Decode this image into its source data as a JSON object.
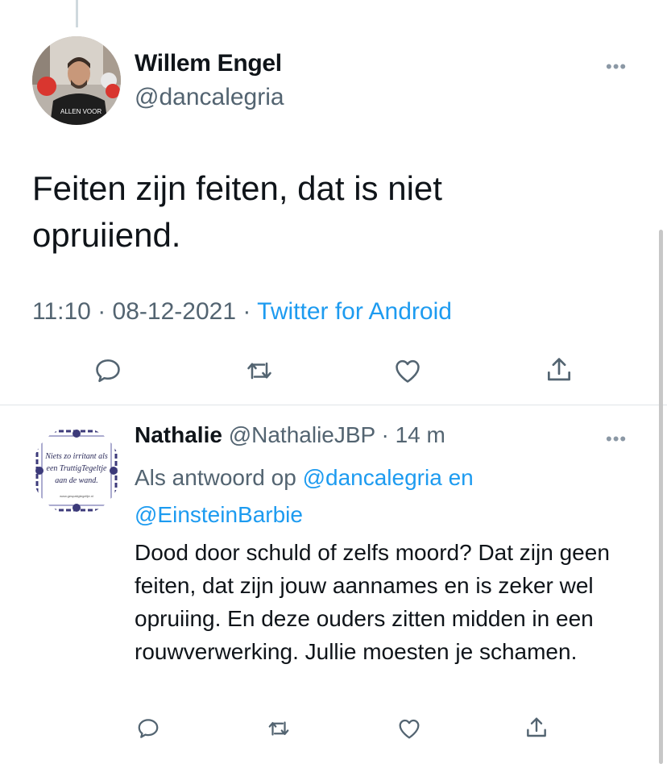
{
  "tweet": {
    "author_name": "Willem Engel",
    "author_handle": "@dancalegria",
    "avatar_shirt_text": "ALLEN VOOR",
    "text": "Feiten zijn feiten, dat is niet opruiiend.",
    "time": "11:10",
    "date": "08-12-2021",
    "separator": "·",
    "source": "Twitter for Android",
    "more_label": "•••"
  },
  "reply": {
    "author_name": "Nathalie",
    "author_handle": "@NathalieJBP",
    "separator": "·",
    "time_ago": "14 m",
    "more_label": "•••",
    "replying_prefix": "Als antwoord op",
    "mention_1": "@dancalegria",
    "conjunction": "en",
    "mention_2": "@EinsteinBarbie",
    "text": "Dood door schuld of zelfs moord? Dat zijn geen feiten, dat zijn jouw aannames en is zeker wel opruiing. En deze ouders zitten midden in een rouwverwerking. Jullie moesten je schamen.",
    "avatar_tile_lines": [
      "Niets zo irritant als",
      "een TruttigTegeltje",
      "aan de wand."
    ],
    "avatar_tile_footer": "www.gespatigtegeltje.nl"
  },
  "icons": {
    "reply": "reply-icon",
    "retweet": "retweet-icon",
    "like": "heart-icon",
    "share": "share-icon",
    "more": "more-icon"
  },
  "colors": {
    "link": "#1d9bf0",
    "secondary_text": "#536471",
    "primary_text": "#0f1419",
    "icon": "#536471"
  }
}
